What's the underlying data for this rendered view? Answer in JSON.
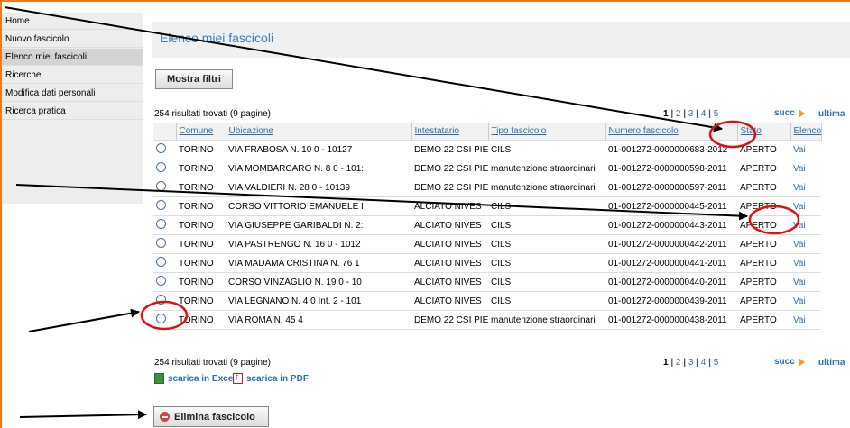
{
  "sidebar": {
    "items": [
      {
        "label": "Home"
      },
      {
        "label": "Nuovo fascicolo"
      },
      {
        "label": "Elenco miei fascicoli"
      },
      {
        "label": "Ricerche"
      },
      {
        "label": "Modifica dati personali"
      },
      {
        "label": "Ricerca pratica"
      }
    ]
  },
  "header": {
    "title": "Elenco miei fascicoli"
  },
  "toolbar": {
    "filters_label": "Mostra filtri"
  },
  "results": {
    "summary": "254 risultati trovati (9 pagine)"
  },
  "pagination": {
    "pages": [
      "1",
      "2",
      "3",
      "4",
      "5"
    ],
    "next_label": "succ",
    "last_label": "ultima"
  },
  "table": {
    "columns": [
      "Comune",
      "Ubicazione",
      "Intestatario",
      "Tipo fascicolo",
      "Numero fascicolo",
      "Stato",
      "Elenco istan"
    ],
    "rows": [
      [
        "TORINO",
        "VIA FRABOSA N. 10 0 - 10127",
        "DEMO 22 CSI PIEM",
        "CILS",
        "01-001272-0000000683-2012",
        "APERTO",
        "Vai"
      ],
      [
        "TORINO",
        "VIA MOMBARCARO N. 8 0 - 101:",
        "DEMO 22 CSI PIEM",
        "manutenzione straordinari",
        "01-001272-0000000598-2011",
        "APERTO",
        "Vai"
      ],
      [
        "TORINO",
        "VIA VALDIERI N. 28 0 - 10139",
        "DEMO 22 CSI PIEM",
        "manutenzione straordinari",
        "01-001272-0000000597-2011",
        "APERTO",
        "Vai"
      ],
      [
        "TORINO",
        "CORSO VITTORIO EMANUELE I",
        "ALCIATO NIVES",
        "CILS",
        "01-001272-0000000445-2011",
        "APERTO",
        "Vai"
      ],
      [
        "TORINO",
        "VIA GIUSEPPE GARIBALDI N. 2:",
        "ALCIATO NIVES",
        "CILS",
        "01-001272-0000000443-2011",
        "APERTO",
        "Vai"
      ],
      [
        "TORINO",
        "VIA PASTRENGO N. 16 0 - 1012",
        "ALCIATO NIVES",
        "CILS",
        "01-001272-0000000442-2011",
        "APERTO",
        "Vai"
      ],
      [
        "TORINO",
        "VIA MADAMA CRISTINA N. 76 1",
        "ALCIATO NIVES",
        "CILS",
        "01-001272-0000000441-2011",
        "APERTO",
        "Vai"
      ],
      [
        "TORINO",
        "CORSO VINZAGLIO N. 19 0 - 10",
        "ALCIATO NIVES",
        "CILS",
        "01-001272-0000000440-2011",
        "APERTO",
        "Vai"
      ],
      [
        "TORINO",
        "VIA LEGNANO N. 4 0 Int. 2 - 101",
        "ALCIATO NIVES",
        "CILS",
        "01-001272-0000000439-2011",
        "APERTO",
        "Vai"
      ],
      [
        "TORINO",
        "VIA ROMA N. 45 4",
        "DEMO 22 CSI PIEM",
        "manutenzione straordinari",
        "01-001272-0000000438-2011",
        "APERTO",
        "Vai"
      ]
    ]
  },
  "downloads": {
    "excel_label": "scarica in Excel",
    "pdf_label": "scarica in PDF"
  },
  "actions": {
    "delete_label": "Elimina fascicolo"
  },
  "colors": {
    "accent_orange": "#f07a1a",
    "link_blue": "#2a6fb0",
    "annotation_red": "#e01010",
    "title_blue": "#3c7fb5"
  },
  "icons": {
    "excel": "excel-icon",
    "pdf": "pdf-icon",
    "next": "next-arrow-icon",
    "delete": "delete-icon"
  }
}
